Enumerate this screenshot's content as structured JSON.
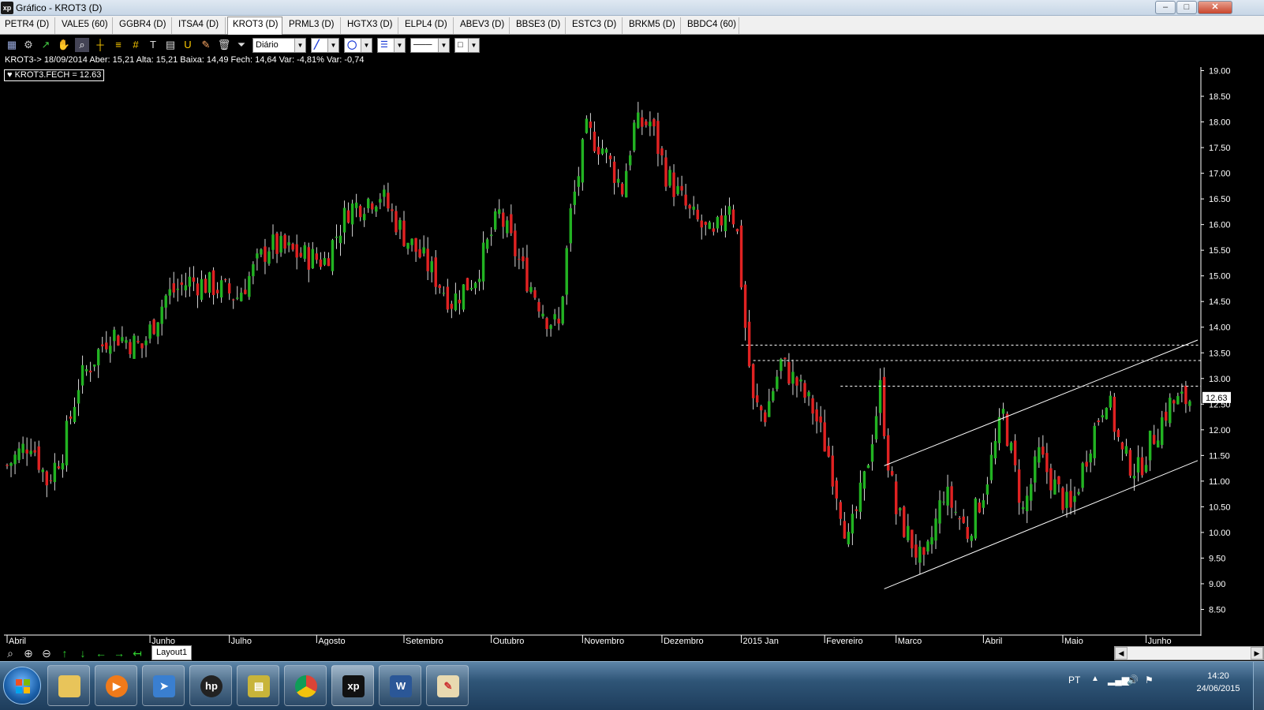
{
  "window": {
    "title": "Gráfico - KROT3 (D)",
    "controls": [
      "minimize",
      "maximize",
      "close"
    ]
  },
  "tabs": [
    {
      "label": "PETR4 (D)",
      "active": false
    },
    {
      "label": "VALE5 (60)",
      "active": false
    },
    {
      "label": "GGBR4 (D)",
      "active": false
    },
    {
      "label": "ITSA4 (D)",
      "active": false
    },
    {
      "label": "KROT3 (D)",
      "active": true
    },
    {
      "label": "PRML3 (D)",
      "active": false
    },
    {
      "label": "HGTX3 (D)",
      "active": false
    },
    {
      "label": "ELPL4 (D)",
      "active": false
    },
    {
      "label": "ABEV3 (D)",
      "active": false
    },
    {
      "label": "BBSE3 (D)",
      "active": false
    },
    {
      "label": "ESTC3 (D)",
      "active": false
    },
    {
      "label": "BRKM5 (D)",
      "active": false
    },
    {
      "label": "BBDC4 (60)",
      "active": false
    }
  ],
  "toolbar": {
    "icons": [
      "chart-icon",
      "gear-icon",
      "trend-icon",
      "hand-icon",
      "magnify-chart-icon",
      "crosshair-icon",
      "fibonacci-icon",
      "grid-icon",
      "text-icon",
      "calculator-icon",
      "magnet-icon",
      "brush-icon",
      "trash-icon",
      "filter-icon"
    ],
    "period_select": "Diário"
  },
  "info": {
    "line": "KROT3-> 18/09/2014 Aber: 15,21 Alta: 15,21 Baixa: 14,49 Fech: 14,64 Var: -4,81% Var: -0,74",
    "legend": "KROT3.FECH = 12.63"
  },
  "chart_data": {
    "type": "candlestick",
    "symbol": "KROT3",
    "period": "D",
    "last_price": 12.63,
    "y_ticks": [
      8.5,
      9.0,
      9.5,
      10.0,
      10.5,
      11.0,
      11.5,
      12.0,
      12.5,
      13.0,
      13.5,
      14.0,
      14.5,
      15.0,
      15.5,
      16.0,
      16.5,
      17.0,
      17.5,
      18.0,
      18.5,
      19.0
    ],
    "y_tick_labels": [
      "8.50",
      "9.00",
      "9.50",
      "10.00",
      "10.50",
      "11.00",
      "11.50",
      "12.00",
      "12.50",
      "13.00",
      "13.50",
      "14.00",
      "14.50",
      "15.00",
      "15.50",
      "16.00",
      "16.50",
      "17.00",
      "17.50",
      "18.00",
      "18.50",
      "19.00"
    ],
    "ylim": [
      8.0,
      19.3
    ],
    "x_months": [
      {
        "label": "Abril",
        "index": 0
      },
      {
        "label": "Junho",
        "index": 36
      },
      {
        "label": "Julho",
        "index": 56
      },
      {
        "label": "Agosto",
        "index": 78
      },
      {
        "label": "Setembro",
        "index": 100
      },
      {
        "label": "Outubro",
        "index": 122
      },
      {
        "label": "Novembro",
        "index": 145
      },
      {
        "label": "Dezembro",
        "index": 165
      },
      {
        "label": "2015 Jan",
        "index": 185
      },
      {
        "label": "Fevereiro",
        "index": 206
      },
      {
        "label": "Marco",
        "index": 224
      },
      {
        "label": "Abril",
        "index": 246
      },
      {
        "label": "Maio",
        "index": 266
      },
      {
        "label": "Junho",
        "index": 287
      }
    ],
    "anchors": [
      [
        0,
        11.3
      ],
      [
        6,
        11.8
      ],
      [
        10,
        11.0
      ],
      [
        14,
        11.6
      ],
      [
        18,
        12.9
      ],
      [
        26,
        13.9
      ],
      [
        34,
        13.6
      ],
      [
        40,
        14.6
      ],
      [
        46,
        14.9
      ],
      [
        52,
        14.8
      ],
      [
        58,
        14.6
      ],
      [
        66,
        15.6
      ],
      [
        74,
        15.4
      ],
      [
        80,
        15.3
      ],
      [
        86,
        16.3
      ],
      [
        94,
        16.6
      ],
      [
        100,
        15.8
      ],
      [
        106,
        15.2
      ],
      [
        112,
        14.5
      ],
      [
        118,
        15.0
      ],
      [
        124,
        16.2
      ],
      [
        130,
        15.1
      ],
      [
        136,
        14.2
      ],
      [
        139,
        14.0
      ],
      [
        142,
        16.2
      ],
      [
        146,
        17.8
      ],
      [
        150,
        17.5
      ],
      [
        155,
        16.7
      ],
      [
        158,
        17.9
      ],
      [
        162,
        18.0
      ],
      [
        166,
        17.0
      ],
      [
        172,
        16.2
      ],
      [
        178,
        15.7
      ],
      [
        182,
        16.5
      ],
      [
        184,
        15.8
      ],
      [
        186,
        14.0
      ],
      [
        188,
        12.5
      ],
      [
        191,
        12.3
      ],
      [
        195,
        13.3
      ],
      [
        199,
        12.9
      ],
      [
        203,
        12.4
      ],
      [
        207,
        11.5
      ],
      [
        210,
        10.5
      ],
      [
        212,
        9.8
      ],
      [
        216,
        11.0
      ],
      [
        220,
        12.8
      ],
      [
        222,
        11.4
      ],
      [
        224,
        10.4
      ],
      [
        228,
        9.8
      ],
      [
        231,
        9.3
      ],
      [
        236,
        10.8
      ],
      [
        242,
        10.0
      ],
      [
        246,
        10.8
      ],
      [
        251,
        12.3
      ],
      [
        256,
        10.4
      ],
      [
        260,
        11.5
      ],
      [
        264,
        10.9
      ],
      [
        268,
        10.4
      ],
      [
        273,
        11.8
      ],
      [
        277,
        12.7
      ],
      [
        281,
        11.5
      ],
      [
        285,
        11.2
      ],
      [
        289,
        11.9
      ],
      [
        293,
        12.5
      ],
      [
        298,
        12.6
      ]
    ],
    "hlines": [
      13.65,
      13.35,
      12.85
    ],
    "channel_upper": {
      "from": [
        221,
        11.3
      ],
      "to": [
        300,
        13.75
      ]
    },
    "channel_lower": {
      "from": [
        221,
        8.9
      ],
      "to": [
        300,
        11.4
      ]
    },
    "colors": {
      "up": "#22b322",
      "down": "#e02222",
      "wick": "#d8d8d8",
      "axis": "#ffffff",
      "background": "#000000"
    }
  },
  "bottom": {
    "tools": [
      "zoom-out-icon",
      "zoom-in-icon",
      "zoom-reset-icon",
      "arrow-up-icon",
      "arrow-down-icon",
      "arrow-left-icon",
      "arrow-right-icon",
      "arrow-end-icon"
    ],
    "layout_tab": "Layout1"
  },
  "taskbar": {
    "apps": [
      "explorer",
      "media-player",
      "network-app",
      "hp-app",
      "calculator-app",
      "chrome",
      "xp-trading",
      "word",
      "paint"
    ],
    "xp_label": "xp",
    "word_label": "W",
    "language": "PT",
    "time": "14:20",
    "date": "24/06/2015"
  }
}
